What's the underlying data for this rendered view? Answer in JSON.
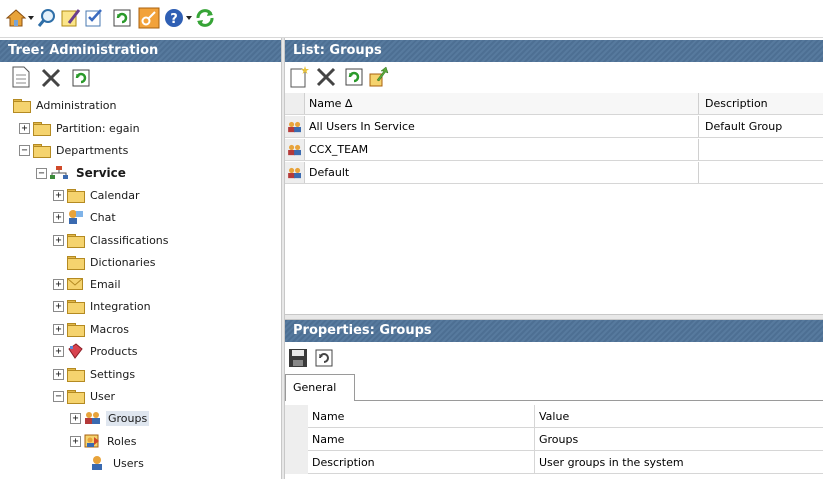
{
  "toolbar": {
    "icons": [
      "home-icon",
      "search-icon",
      "edit-note-icon",
      "checklist-icon",
      "refresh-icon",
      "key-icon",
      "help-icon",
      "sync-icon"
    ]
  },
  "left_panel": {
    "title": "Tree: Administration",
    "toolbar_icons": [
      "new-document-icon",
      "delete-icon",
      "refresh-icon"
    ]
  },
  "tree": {
    "items": [
      {
        "label": "Administration",
        "expander": ""
      },
      {
        "label": "Partition: egain",
        "expander": "+"
      },
      {
        "label": "Departments",
        "expander": "−"
      },
      {
        "label": "Service",
        "expander": "−"
      },
      {
        "label": "Calendar",
        "expander": "+"
      },
      {
        "label": "Chat",
        "expander": "+"
      },
      {
        "label": "Classifications",
        "expander": "+"
      },
      {
        "label": "Dictionaries",
        "expander": ""
      },
      {
        "label": "Email",
        "expander": "+"
      },
      {
        "label": "Integration",
        "expander": "+"
      },
      {
        "label": "Macros",
        "expander": "+"
      },
      {
        "label": "Products",
        "expander": "+"
      },
      {
        "label": "Settings",
        "expander": "+"
      },
      {
        "label": "User",
        "expander": "−"
      },
      {
        "label": "Groups",
        "expander": "+"
      },
      {
        "label": "Roles",
        "expander": "+"
      },
      {
        "label": "Users",
        "expander": ""
      }
    ]
  },
  "list_panel": {
    "title": "List: Groups",
    "toolbar_icons": [
      "new-item-icon",
      "delete-icon",
      "refresh-icon",
      "export-icon"
    ],
    "columns": {
      "name": "Name ∆",
      "description": "Description"
    },
    "rows": [
      {
        "name": "All Users In Service",
        "description": "Default Group"
      },
      {
        "name": "CCX_TEAM",
        "description": ""
      },
      {
        "name": "Default",
        "description": ""
      }
    ]
  },
  "properties_panel": {
    "title": "Properties: Groups",
    "toolbar_icons": [
      "save-icon",
      "refresh-icon"
    ],
    "tab": "General",
    "columns": {
      "name": "Name",
      "value": "Value"
    },
    "rows": [
      {
        "name": "Name",
        "value": "Groups"
      },
      {
        "name": "Description",
        "value": "User groups in the system"
      }
    ]
  },
  "colors": {
    "title_bar": "#4d6f93",
    "folder": "#f5d36e",
    "selection": "#dfe6ef"
  }
}
